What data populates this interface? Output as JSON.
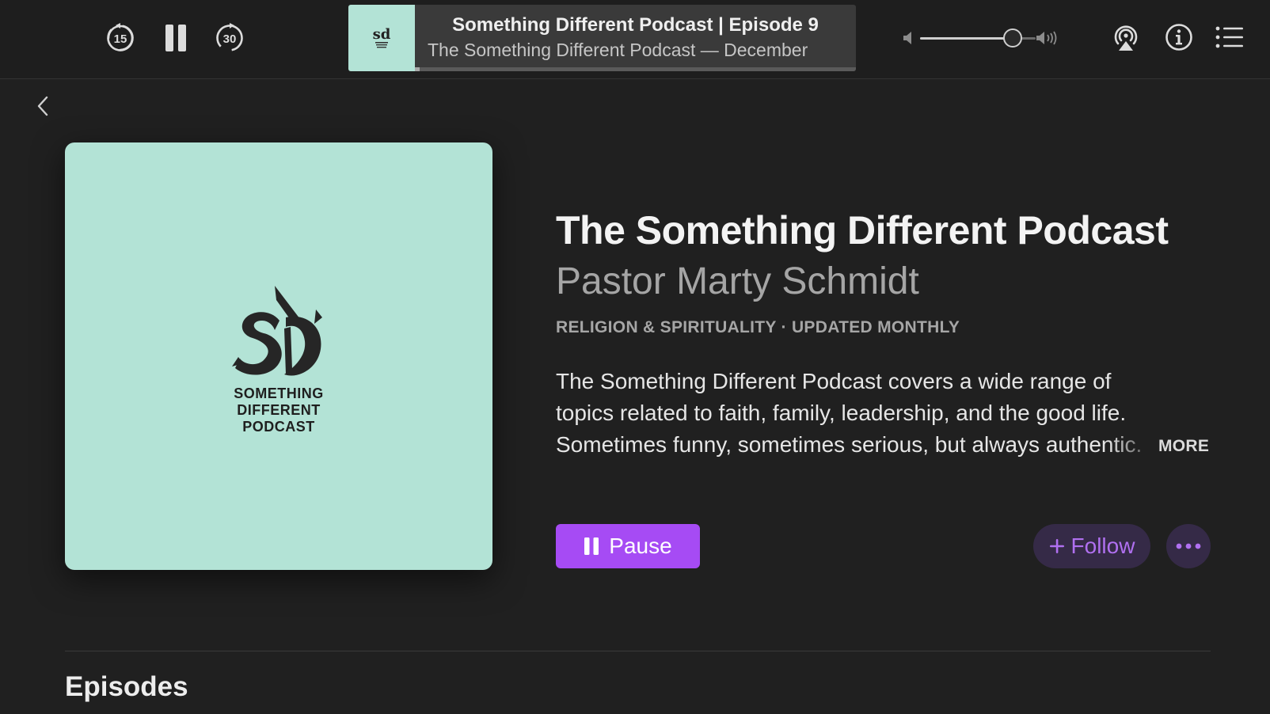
{
  "toolbar": {
    "skip_back_label": "15",
    "skip_forward_label": "30",
    "now_playing": {
      "title": "Something Different Podcast | Episode 9",
      "subtitle": "The Something Different Podcast — December",
      "progress": 0.01
    },
    "volume": {
      "level": 0.8
    }
  },
  "podcast": {
    "cover_text": [
      "SOMETHING",
      "DIFFERENT",
      "PODCAST"
    ],
    "title": "The Something Different Podcast",
    "author": "Pastor Marty Schmidt",
    "category": "RELIGION & SPIRITUALITY",
    "separator": "·",
    "update_frequency": "UPDATED MONTHLY",
    "description": "The Something Different Podcast covers a wide range of topics related to faith, family, leadership, and the good life. Sometimes funny, sometimes serious, but always authentic.",
    "more_label": "MORE"
  },
  "actions": {
    "pause_label": "Pause",
    "follow_label": "Follow"
  },
  "sections": {
    "episodes_heading": "Episodes"
  },
  "colors": {
    "accent": "#a64bf4",
    "follow_bg": "#352a47",
    "follow_text": "#b070f0",
    "cover_bg": "#b3e3d6",
    "background": "#202020"
  },
  "icons": {
    "skip_back": "skip-back-15-icon",
    "pause": "pause-icon",
    "skip_forward": "skip-forward-30-icon",
    "volume_low": "volume-low-icon",
    "volume_high": "volume-high-icon",
    "airplay": "airplay-icon",
    "info": "info-icon",
    "queue": "queue-list-icon",
    "back": "chevron-left-icon",
    "plus": "plus-icon",
    "ellipsis": "ellipsis-icon"
  }
}
